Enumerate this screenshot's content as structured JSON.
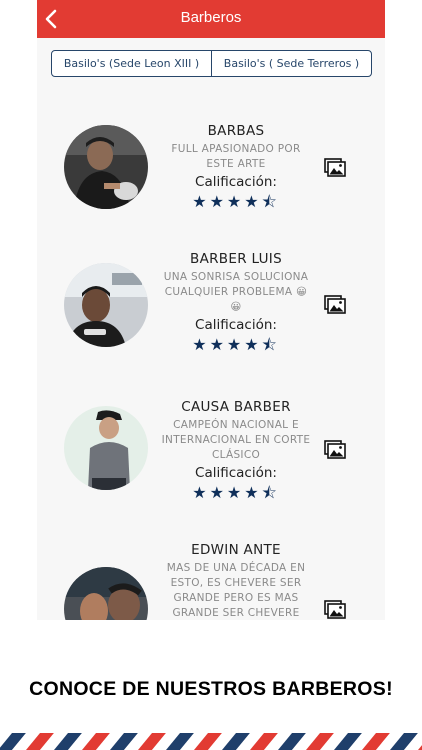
{
  "header": {
    "title": "Barberos",
    "back_icon": "chevron-left-icon"
  },
  "locations": [
    {
      "label": "Basilo's (Sede Leon XIII )"
    },
    {
      "label": "Basilo's ( Sede Terreros )"
    }
  ],
  "barbers": [
    {
      "name": "BARBAS",
      "description": "FULL APASIONADO POR ESTE ARTE",
      "rating_label": "Calificación:",
      "rating": 4.5,
      "gallery_icon": "image-gallery-icon"
    },
    {
      "name": "BARBER LUIS",
      "description": "UNA SONRISA SOLUCIONA CUALQUIER PROBLEMA 😀 😀",
      "rating_label": "Calificación:",
      "rating": 4.5,
      "gallery_icon": "image-gallery-icon"
    },
    {
      "name": "CAUSA BARBER",
      "description": "CAMPEÓN NACIONAL E INTERNACIONAL EN CORTE CLÁSICO",
      "rating_label": "Calificación:",
      "rating": 4.5,
      "gallery_icon": "image-gallery-icon"
    },
    {
      "name": "EDWIN ANTE",
      "description": "MAS DE UNA DÉCADA EN ESTO, ES CHEVERE SER GRANDE PERO ES MAS GRANDE SER CHEVERE",
      "rating_label": "",
      "rating": null,
      "gallery_icon": "image-gallery-icon"
    }
  ],
  "caption": "CONOCE DE NUESTROS BARBEROS!",
  "colors": {
    "appbar": "#e23b33",
    "navy": "#0f2f5a",
    "stripe_red": "#e23b33",
    "stripe_blue": "#1f3f6b"
  }
}
